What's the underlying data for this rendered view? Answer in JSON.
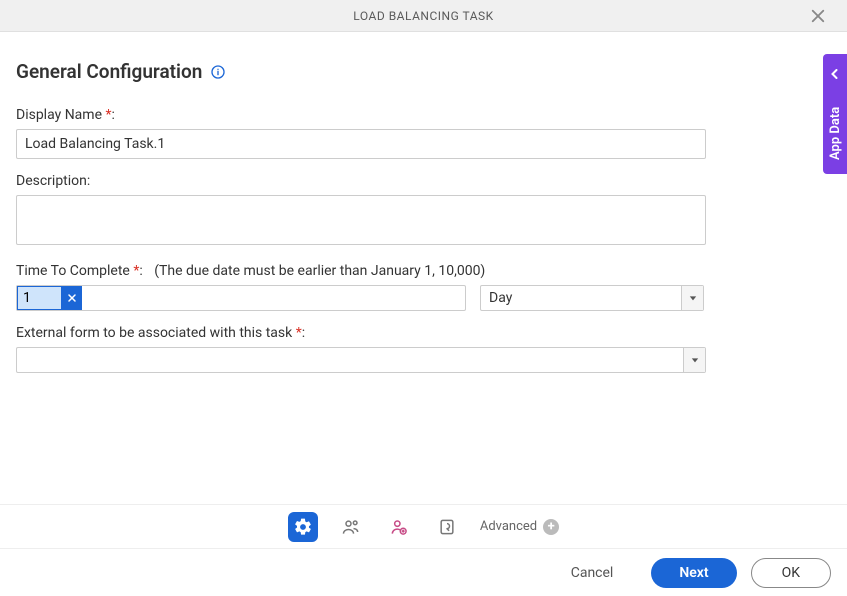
{
  "header": {
    "title": "LOAD BALANCING TASK"
  },
  "section": {
    "title": "General Configuration"
  },
  "form": {
    "displayName": {
      "label": "Display Name",
      "required_marker": "*",
      "value": "Load Balancing Task.1"
    },
    "description": {
      "label": "Description:",
      "value": ""
    },
    "time": {
      "label": "Time To Complete",
      "required_marker": "*",
      "hint": "(The due date must be earlier than January 1, 10,000)",
      "value": "1",
      "unit": "Day"
    },
    "externalForm": {
      "label": "External form to be associated with this task",
      "required_marker": "*",
      "value": ""
    }
  },
  "bottomNav": {
    "advanced_label": "Advanced"
  },
  "footer": {
    "cancel": "Cancel",
    "next": "Next",
    "ok": "OK"
  },
  "sideTab": {
    "label": "App Data"
  }
}
